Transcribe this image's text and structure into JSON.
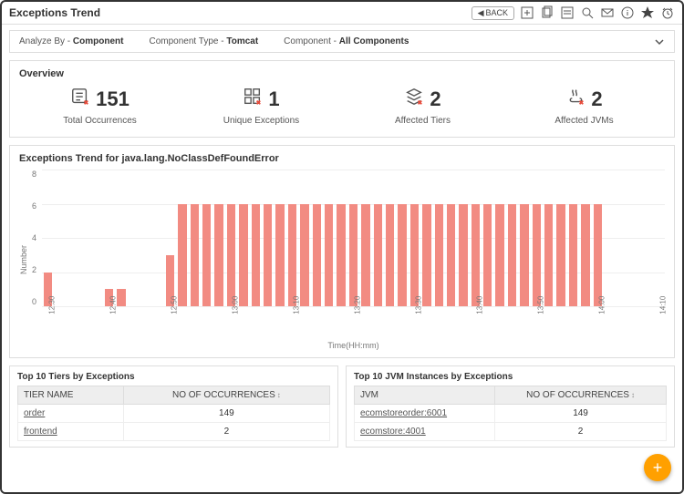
{
  "header": {
    "title": "Exceptions Trend",
    "back_label": "BACK"
  },
  "filters": {
    "analyze_by_label": "Analyze By -",
    "analyze_by_value": "Component",
    "component_type_label": "Component Type -",
    "component_type_value": "Tomcat",
    "component_label": "Component -",
    "component_value": "All Components"
  },
  "overview": {
    "title": "Overview",
    "stats": [
      {
        "value": "151",
        "label": "Total Occurrences",
        "icon": "occurrences"
      },
      {
        "value": "1",
        "label": "Unique Exceptions",
        "icon": "unique"
      },
      {
        "value": "2",
        "label": "Affected Tiers",
        "icon": "tiers"
      },
      {
        "value": "2",
        "label": "Affected JVMs",
        "icon": "jvms"
      }
    ]
  },
  "chart": {
    "title": "Exceptions Trend for java.lang.NoClassDefFoundError",
    "ylabel": "Number",
    "xlabel": "Time(HH:mm)"
  },
  "chart_data": {
    "type": "bar",
    "title": "Exceptions Trend for java.lang.NoClassDefFoundError",
    "xlabel": "Time(HH:mm)",
    "ylabel": "Number",
    "ylim": [
      0,
      8
    ],
    "yticks": [
      0,
      2,
      4,
      6,
      8
    ],
    "categories": [
      "12:30",
      "",
      "",
      "",
      "",
      "12:40",
      "",
      "",
      "",
      "",
      "12:50",
      "",
      "",
      "",
      "",
      "13:00",
      "",
      "",
      "",
      "",
      "13:10",
      "",
      "",
      "",
      "",
      "13:20",
      "",
      "",
      "",
      "",
      "13:30",
      "",
      "",
      "",
      "",
      "13:40",
      "",
      "",
      "",
      "",
      "13:50",
      "",
      "",
      "",
      "",
      "14:00",
      "",
      "",
      "",
      "",
      "14:10"
    ],
    "xtick_labels": [
      "12:30",
      "12:40",
      "12:50",
      "13:00",
      "13:10",
      "13:20",
      "13:30",
      "13:40",
      "13:50",
      "14:00",
      "14:10"
    ],
    "values": [
      2,
      0,
      0,
      0,
      0,
      1,
      1,
      0,
      0,
      0,
      3,
      6,
      6,
      6,
      6,
      6,
      6,
      6,
      6,
      6,
      6,
      6,
      6,
      6,
      6,
      6,
      6,
      6,
      6,
      6,
      6,
      6,
      6,
      6,
      6,
      6,
      6,
      6,
      6,
      6,
      6,
      6,
      6,
      6,
      6,
      6,
      0,
      0,
      0,
      0,
      0
    ]
  },
  "tiers_table": {
    "title": "Top 10 Tiers by Exceptions",
    "col1": "TIER NAME",
    "col2": "NO OF OCCURRENCES",
    "rows": [
      {
        "name": "order",
        "count": "149"
      },
      {
        "name": "frontend",
        "count": "2"
      }
    ]
  },
  "jvm_table": {
    "title": "Top 10 JVM Instances by Exceptions",
    "col1": "JVM",
    "col2": "NO OF OCCURRENCES",
    "rows": [
      {
        "name": "ecomstoreorder:6001",
        "count": "149"
      },
      {
        "name": "ecomstore:4001",
        "count": "2"
      }
    ]
  }
}
